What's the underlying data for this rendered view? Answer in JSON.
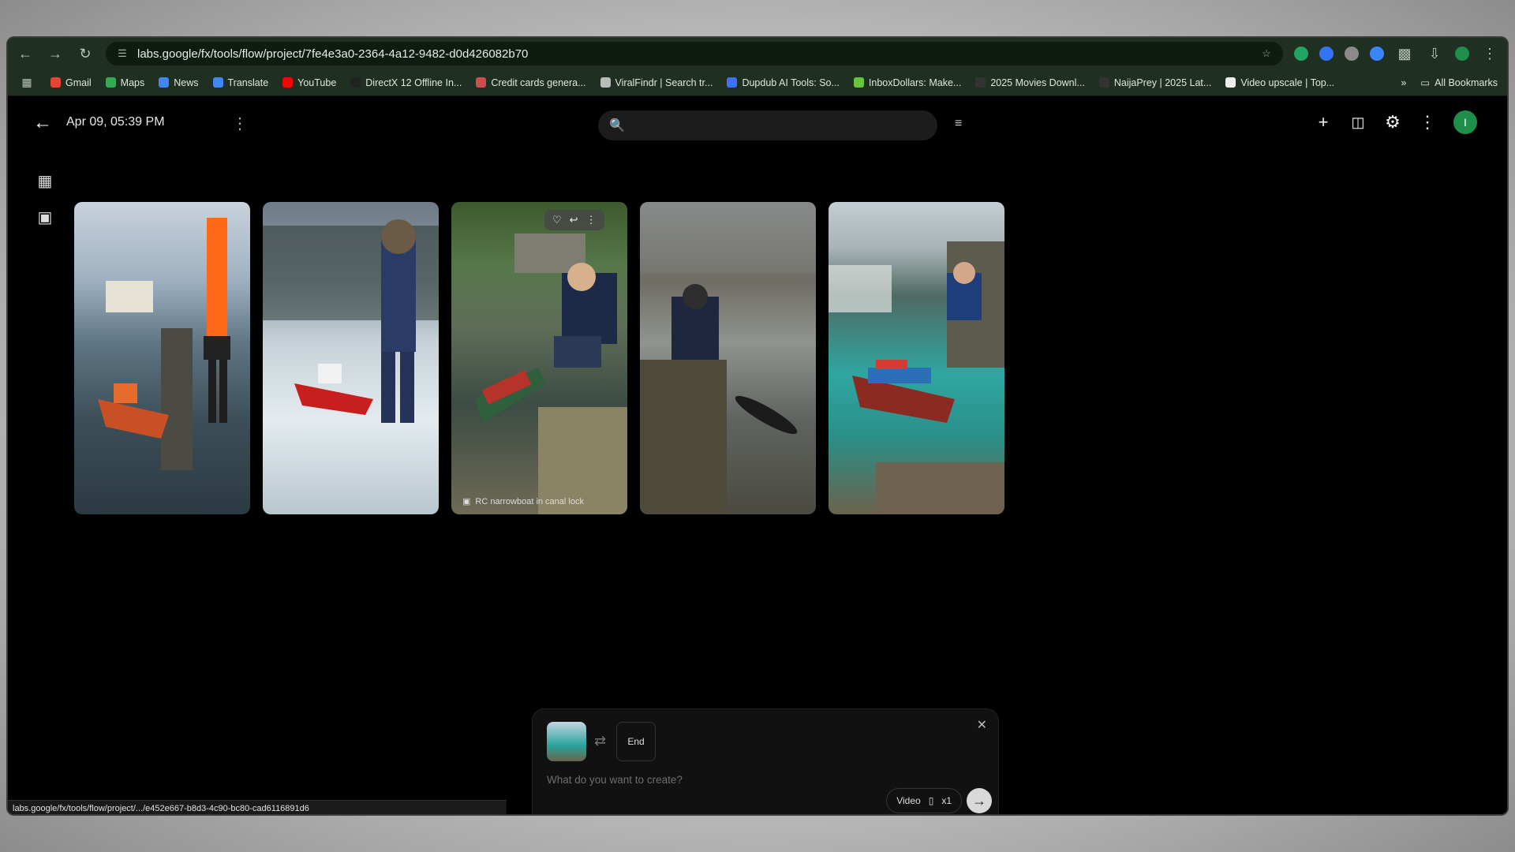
{
  "browser": {
    "url": "labs.google/fx/tools/flow/project/7fe4e3a0-2364-4a12-9482-d0d426082b70",
    "bookmarks": [
      {
        "label": "Gmail",
        "color": "#ea4335"
      },
      {
        "label": "Maps",
        "color": "#34a853"
      },
      {
        "label": "News",
        "color": "#4285f4"
      },
      {
        "label": "Translate",
        "color": "#4285f4"
      },
      {
        "label": "YouTube",
        "color": "#ff0000"
      },
      {
        "label": "DirectX 12 Offline In...",
        "color": "#222222"
      },
      {
        "label": "Credit cards genera...",
        "color": "#d04d4d"
      },
      {
        "label": "ViralFindr | Search tr...",
        "color": "#bbbbbb"
      },
      {
        "label": "Dupdub AI Tools: So...",
        "color": "#3b73ff"
      },
      {
        "label": "InboxDollars: Make...",
        "color": "#66c43c"
      },
      {
        "label": "2025 Movies Downl...",
        "color": "#333333"
      },
      {
        "label": "NaijaPrey | 2025 Lat...",
        "color": "#333333"
      },
      {
        "label": "Video upscale | Top...",
        "color": "#eeeeee"
      }
    ],
    "all_bookmarks": "All Bookmarks",
    "status_url": "labs.google/fx/tools/flow/project/.../e452e667-b8d3-4c90-bc80-cad6116891d6"
  },
  "app": {
    "title": "Apr 09, 05:39 PM",
    "search_placeholder": "",
    "avatar_initial": "I",
    "accent_color": "#1e8e4b"
  },
  "gallery": {
    "items": [
      {
        "alt": "RC tugboat in harbor"
      },
      {
        "alt": "RC boat in snowy lake"
      },
      {
        "alt": "RC narrowboat in canal lock",
        "caption": "RC narrowboat in canal lock"
      },
      {
        "alt": "RC submarine in river"
      },
      {
        "alt": "RC container ship in cove"
      }
    ]
  },
  "composer": {
    "end_label": "End",
    "prompt_placeholder": "What do you want to create?",
    "mode_label": "Video",
    "count_label": "x1"
  }
}
